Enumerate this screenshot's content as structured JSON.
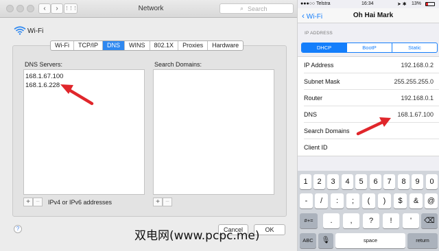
{
  "mac": {
    "window_title": "Network",
    "search_placeholder": "Search",
    "back_glyph": "‹",
    "forward_glyph": "›",
    "grid_glyph": "⋮⋮⋮",
    "interface_name": "Wi-Fi",
    "tabs": [
      {
        "label": "Wi-Fi",
        "active": false
      },
      {
        "label": "TCP/IP",
        "active": false
      },
      {
        "label": "DNS",
        "active": true
      },
      {
        "label": "WINS",
        "active": false
      },
      {
        "label": "802.1X",
        "active": false
      },
      {
        "label": "Proxies",
        "active": false
      },
      {
        "label": "Hardware",
        "active": false
      }
    ],
    "dns_servers_label": "DNS Servers:",
    "dns_servers": [
      "168.1.67.100",
      "168.1.6.228"
    ],
    "search_domains_label": "Search Domains:",
    "plus_label": "+",
    "minus_label": "−",
    "address_hint": "IPv4 or IPv6 addresses",
    "help_label": "?",
    "cancel_label": "Cancel",
    "ok_label": "OK"
  },
  "ios": {
    "status": {
      "carrier": "●●●○○ Telstra",
      "time": "16:34",
      "battery": "13%"
    },
    "back_label": "Wi-Fi",
    "network_name": "Oh Hai Mark",
    "section_header": "IP ADDRESS",
    "segments": [
      {
        "label": "DHCP",
        "active": true
      },
      {
        "label": "BootP",
        "active": false
      },
      {
        "label": "Static",
        "active": false
      }
    ],
    "rows": [
      {
        "label": "IP Address",
        "value": "192.168.0.2"
      },
      {
        "label": "Subnet Mask",
        "value": "255.255.255.0"
      },
      {
        "label": "Router",
        "value": "192.168.0.1"
      },
      {
        "label": "DNS",
        "value": "168.1.67.100"
      },
      {
        "label": "Search Domains",
        "value": ""
      },
      {
        "label": "Client ID",
        "value": ""
      }
    ],
    "keyboard": {
      "row1": [
        "1",
        "2",
        "3",
        "4",
        "5",
        "6",
        "7",
        "8",
        "9",
        "0"
      ],
      "row2": [
        "-",
        "/",
        ":",
        ";",
        "(",
        ")",
        "$",
        "&",
        "@"
      ],
      "row3": [
        ".",
        ",",
        "?",
        "!",
        "'"
      ],
      "shift_label": "#+=",
      "abc_label": "ABC",
      "space_label": "space",
      "return_label": "return"
    }
  },
  "watermark": "双电网(www.pcpc.me)",
  "colors": {
    "accent": "#147efb",
    "mac_tab_active": "#2f88f0",
    "arrow": "#e0262b"
  }
}
